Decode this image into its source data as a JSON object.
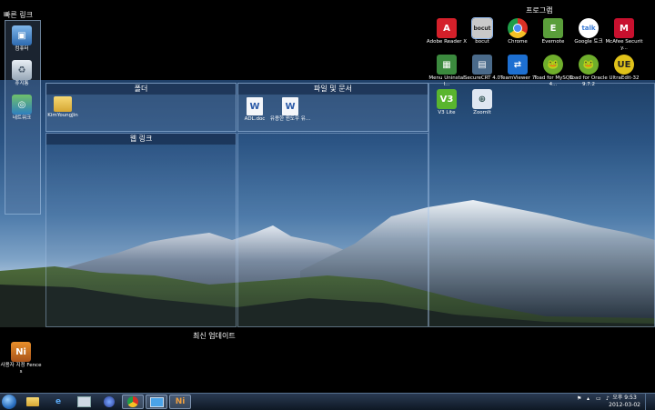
{
  "quick_links": {
    "title": "빠른 링크",
    "items": [
      {
        "label": "컴퓨터",
        "icon": "computer-icon"
      },
      {
        "label": "휴지통",
        "icon": "recycle-bin-icon"
      },
      {
        "label": "네트워크",
        "icon": "network-icon"
      }
    ]
  },
  "programs": {
    "title": "프로그램",
    "items": [
      {
        "label": "Adobe Reader X",
        "icon": "adobe-reader-icon",
        "color": "#d4202a"
      },
      {
        "label": "bocut",
        "icon": "bocut-icon",
        "color": "#c9c9c9"
      },
      {
        "label": "Chrome",
        "icon": "chrome-icon",
        "color": "#e8b826"
      },
      {
        "label": "Evernote",
        "icon": "evernote-icon",
        "color": "#5a9e3a"
      },
      {
        "label": "Google 토크",
        "icon": "google-talk-icon",
        "color": "#7fbfe6"
      },
      {
        "label": "McAfee Security...",
        "icon": "mcafee-icon",
        "color": "#c8102e"
      },
      {
        "label": "Menu Uninstall...",
        "icon": "menu-uninstall-icon",
        "color": "#3b8a3e"
      },
      {
        "label": "SecureCRT 4.0",
        "icon": "securecrt-icon",
        "color": "#4a6a8a"
      },
      {
        "label": "TeamViewer 7",
        "icon": "teamviewer-icon",
        "color": "#1d6fd1"
      },
      {
        "label": "Toad for MySQL 4...",
        "icon": "toad-mysql-icon",
        "color": "#6fae2c"
      },
      {
        "label": "Toad for Oracle 9.7.2",
        "icon": "toad-oracle-icon",
        "color": "#6fae2c"
      },
      {
        "label": "UltraEdit-32",
        "icon": "ultraedit-icon",
        "color": "#e0c21a"
      },
      {
        "label": "V3 Lite",
        "icon": "v3-lite-icon",
        "color": "#59b52e"
      },
      {
        "label": "ZoomIt",
        "icon": "zoomit-icon",
        "color": "#6a8fc0"
      }
    ]
  },
  "folders": {
    "title": "폴더",
    "items": [
      {
        "label": "KimYoungJin",
        "icon": "folder-icon"
      }
    ]
  },
  "files": {
    "title": "파일 및 문서",
    "items": [
      {
        "label": "ADL.doc",
        "icon": "word-doc-icon"
      },
      {
        "label": "유용한 윈도우 유...",
        "icon": "word-doc-icon"
      }
    ]
  },
  "web_links": {
    "title": "웹 링크"
  },
  "recent_updates": {
    "title": "최신 업데이트",
    "items": [
      {
        "label": "사용자 지정 Fences",
        "icon": "fences-icon"
      }
    ]
  },
  "taskbar": {
    "pinned": [
      {
        "name": "explorer-icon"
      },
      {
        "name": "ie-icon"
      },
      {
        "name": "control-panel-icon"
      },
      {
        "name": "media-player-icon"
      },
      {
        "name": "chrome-icon"
      },
      {
        "name": "remote-desktop-icon"
      },
      {
        "name": "fences-icon"
      }
    ],
    "clock_time": "오후 9:53",
    "clock_date": "2012-03-02"
  }
}
